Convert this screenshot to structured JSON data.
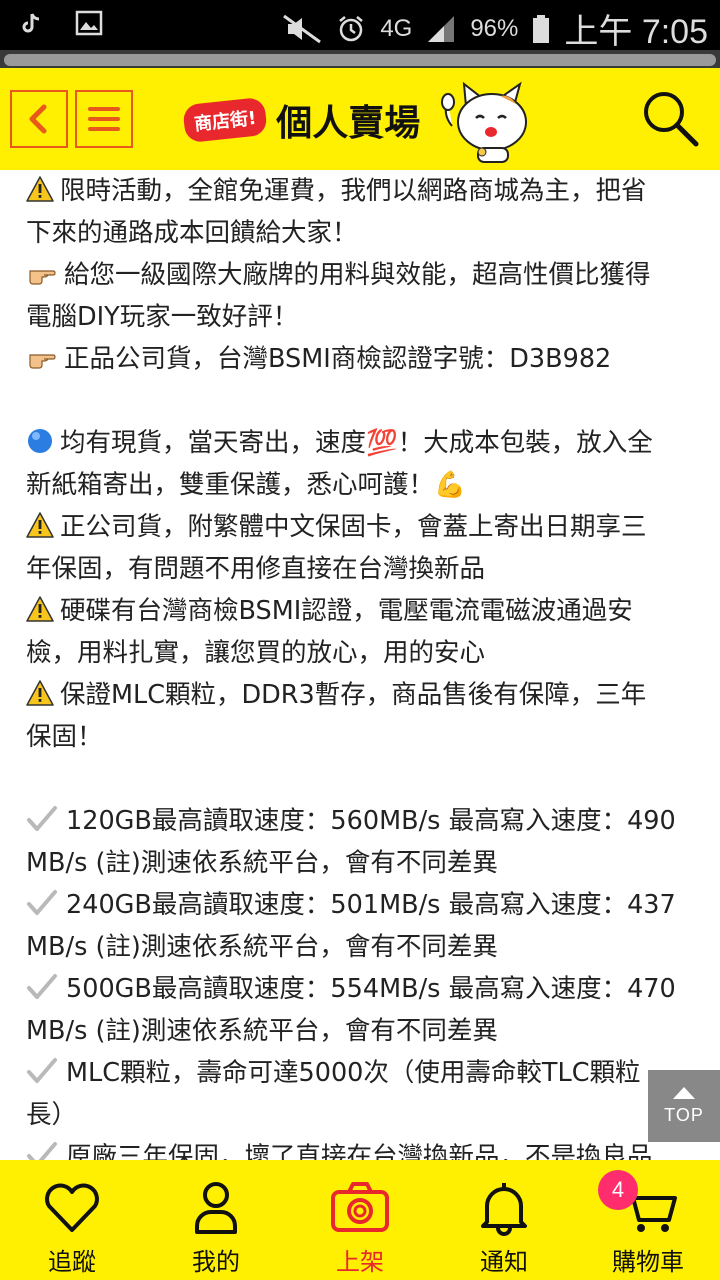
{
  "status_bar": {
    "signal_label": "4G",
    "battery": "96%",
    "clock": "上午 7:05"
  },
  "header": {
    "brand_badge": "商店街!",
    "brand_title": "個人賣場"
  },
  "content": {
    "lines": [
      {
        "icon": "warning",
        "text": "限時活動，全館免運費，我們以網路商城為主，把省"
      },
      {
        "icon": "",
        "text": "下來的通路成本回饋給大家！"
      },
      {
        "icon": "pointing-hand",
        "text": "給您一級國際大廠牌的用料與效能，超高性價比獲得"
      },
      {
        "icon": "",
        "text": "電腦DIY玩家一致好評！"
      },
      {
        "icon": "pointing-hand",
        "text": "正品公司貨，台灣BSMI商檢認證字號：D3B982"
      },
      {
        "icon": "blank",
        "text": ""
      },
      {
        "icon": "blue-circle",
        "text": "均有現貨，當天寄出，速度💯！大成本包裝，放入全"
      },
      {
        "icon": "",
        "text": "新紙箱寄出，雙重保護，悉心呵護！💪"
      },
      {
        "icon": "warning",
        "text": "正公司貨，附繁體中文保固卡，會蓋上寄出日期享三"
      },
      {
        "icon": "",
        "text": "年保固，有問題不用修直接在台灣換新品"
      },
      {
        "icon": "warning",
        "text": "硬碟有台灣商檢BSMI認證，電壓電流電磁波通過安"
      },
      {
        "icon": "",
        "text": "檢，用料扎實，讓您買的放心，用的安心"
      },
      {
        "icon": "warning",
        "text": "保證MLC顆粒，DDR3暫存，商品售後有保障，三年"
      },
      {
        "icon": "",
        "text": "保固！"
      },
      {
        "icon": "blank",
        "text": ""
      },
      {
        "icon": "check",
        "text": "120GB最高讀取速度：560MB/s 最高寫入速度：490"
      },
      {
        "icon": "",
        "text": "MB/s (註)測速依系統平台，會有不同差異"
      },
      {
        "icon": "check",
        "text": "240GB最高讀取速度：501MB/s 最高寫入速度：437"
      },
      {
        "icon": "",
        "text": "MB/s (註)測速依系統平台，會有不同差異"
      },
      {
        "icon": "check",
        "text": "500GB最高讀取速度：554MB/s 最高寫入速度：470"
      },
      {
        "icon": "",
        "text": "MB/s (註)測速依系統平台，會有不同差異"
      },
      {
        "icon": "check",
        "text": "MLC顆粒，壽命可達5000次（使用壽命較TLC顆粒"
      },
      {
        "icon": "",
        "text": "長）"
      },
      {
        "icon": "check",
        "text": "原廠三年保固，壞了直接在台灣換新品，不是換良品"
      }
    ]
  },
  "top_button": {
    "label": "TOP"
  },
  "bottom_nav": {
    "items": [
      {
        "key": "track",
        "label": "追蹤",
        "icon": "heart-icon"
      },
      {
        "key": "mine",
        "label": "我的",
        "icon": "user-icon"
      },
      {
        "key": "list",
        "label": "上架",
        "icon": "camera-icon"
      },
      {
        "key": "notify",
        "label": "通知",
        "icon": "bell-icon"
      },
      {
        "key": "cart",
        "label": "購物車",
        "icon": "cart-icon"
      }
    ],
    "cart_count": "4"
  },
  "colors": {
    "header_bg": "#ffef00",
    "accent": "#e8282d",
    "button_border": "#e85a1b",
    "badge": "#ff2d6e"
  }
}
